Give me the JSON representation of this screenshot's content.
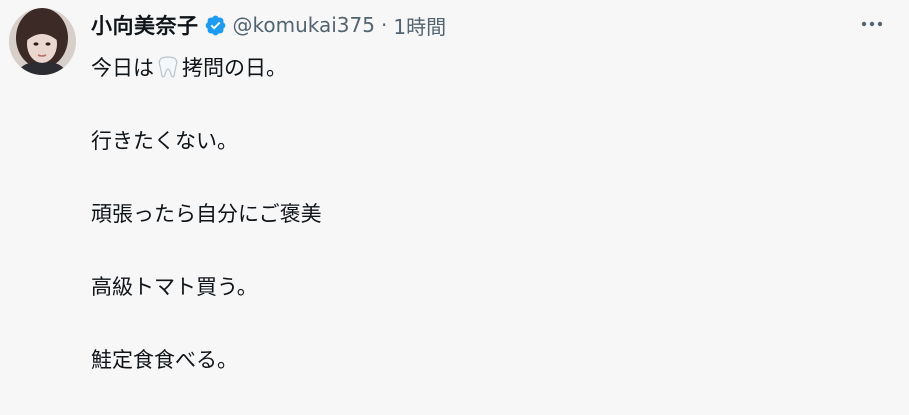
{
  "tweet": {
    "author": {
      "display_name": "小向美奈子",
      "handle": "@komukai375",
      "verified": true,
      "verified_color": "#1d9bf0"
    },
    "separator": "·",
    "time": "1時間",
    "more_icon": "more-horizontal-icon",
    "text": {
      "line1_before": "今日は",
      "line1_emoji": "tooth-emoji",
      "line1_after": "拷問の日。",
      "line2": "行きたくない。",
      "line3": "頑張ったら自分にご褒美",
      "line4": "高級トマト買う。",
      "line5": "鮭定食食べる。"
    }
  }
}
